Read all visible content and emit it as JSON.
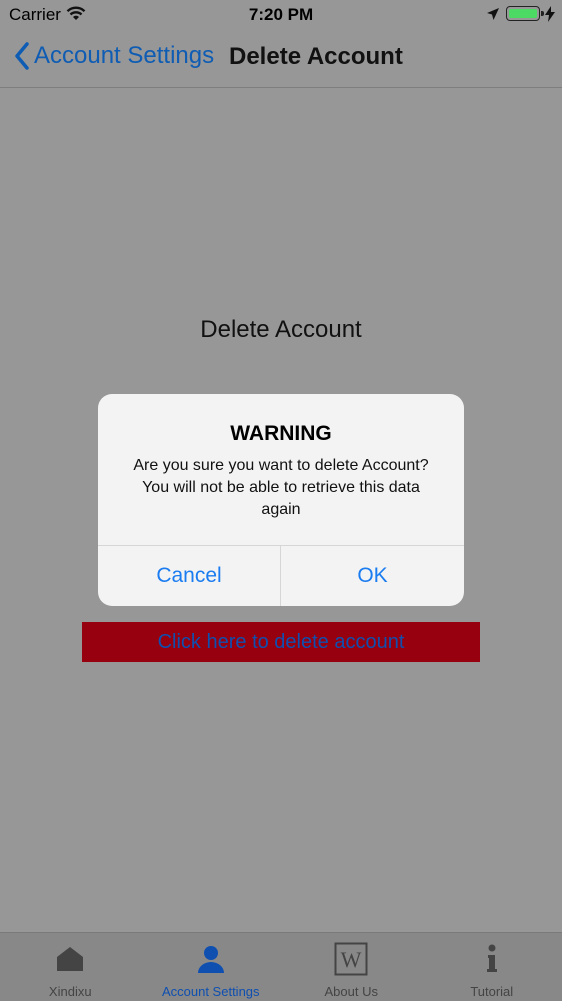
{
  "status_bar": {
    "carrier": "Carrier",
    "time": "7:20 PM",
    "icons": [
      "wifi-icon",
      "location-arrow-icon",
      "battery-icon",
      "charging-bolt-icon"
    ]
  },
  "nav": {
    "back_label": "Account Settings",
    "title": "Delete Account"
  },
  "main": {
    "heading": "Delete Account",
    "delete_button_label": "Click here to delete account"
  },
  "alert": {
    "title": "WARNING",
    "message": "Are you sure you want to delete Account? You will not be able to retrieve this data again",
    "cancel_label": "Cancel",
    "ok_label": "OK"
  },
  "tab_bar": {
    "items": [
      {
        "label": "Xindixu",
        "icon": "house-icon"
      },
      {
        "label": "Account Settings",
        "icon": "person-icon",
        "active": true
      },
      {
        "label": "About Us",
        "icon": "wikipedia-w-icon"
      },
      {
        "label": "Tutorial",
        "icon": "info-icon"
      }
    ]
  },
  "colors": {
    "overlay_background": "#979797",
    "link_blue": "#0e5cb3",
    "alert_button_blue": "#1a7cf0",
    "delete_button_red": "#97000e",
    "battery_green": "#4cd964"
  }
}
